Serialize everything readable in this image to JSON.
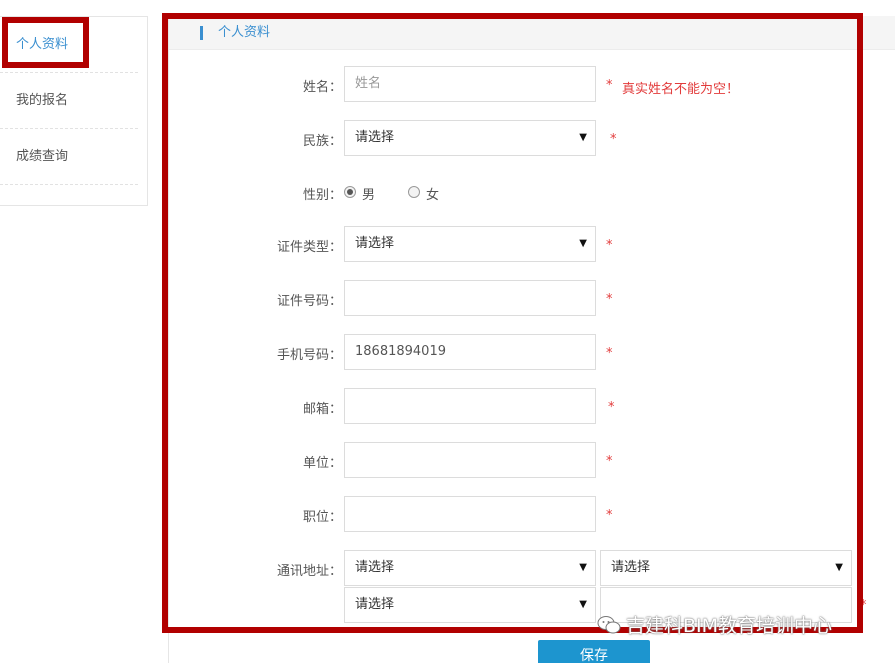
{
  "sidebar": {
    "items": [
      {
        "label": "个人资料"
      },
      {
        "label": "我的报名"
      },
      {
        "label": "成绩查询"
      }
    ]
  },
  "panel": {
    "title": "个人资料"
  },
  "form": {
    "name": {
      "label": "姓名：",
      "placeholder": "姓名",
      "error": "真实姓名不能为空！"
    },
    "ethnicity": {
      "label": "民族：",
      "value": "请选择"
    },
    "gender": {
      "label": "性别：",
      "options": [
        "男",
        "女"
      ],
      "selected": "男"
    },
    "id_type": {
      "label": "证件类型：",
      "value": "请选择"
    },
    "id_number": {
      "label": "证件号码：",
      "value": ""
    },
    "phone": {
      "label": "手机号码：",
      "value": "18681894019"
    },
    "email": {
      "label": "邮箱：",
      "value": ""
    },
    "company": {
      "label": "单位：",
      "value": ""
    },
    "position": {
      "label": "职位：",
      "value": ""
    },
    "address": {
      "label": "通讯地址：",
      "province": "请选择",
      "city": "请选择",
      "district": "请选择",
      "detail": ""
    },
    "required_mark": "*"
  },
  "save_label": "保存",
  "watermark": "吉建科BIM教育培训中心",
  "colors": {
    "accent": "#3a8fd0",
    "highlight": "#b10000",
    "error": "#e23b3b",
    "button": "#1d95cf"
  }
}
